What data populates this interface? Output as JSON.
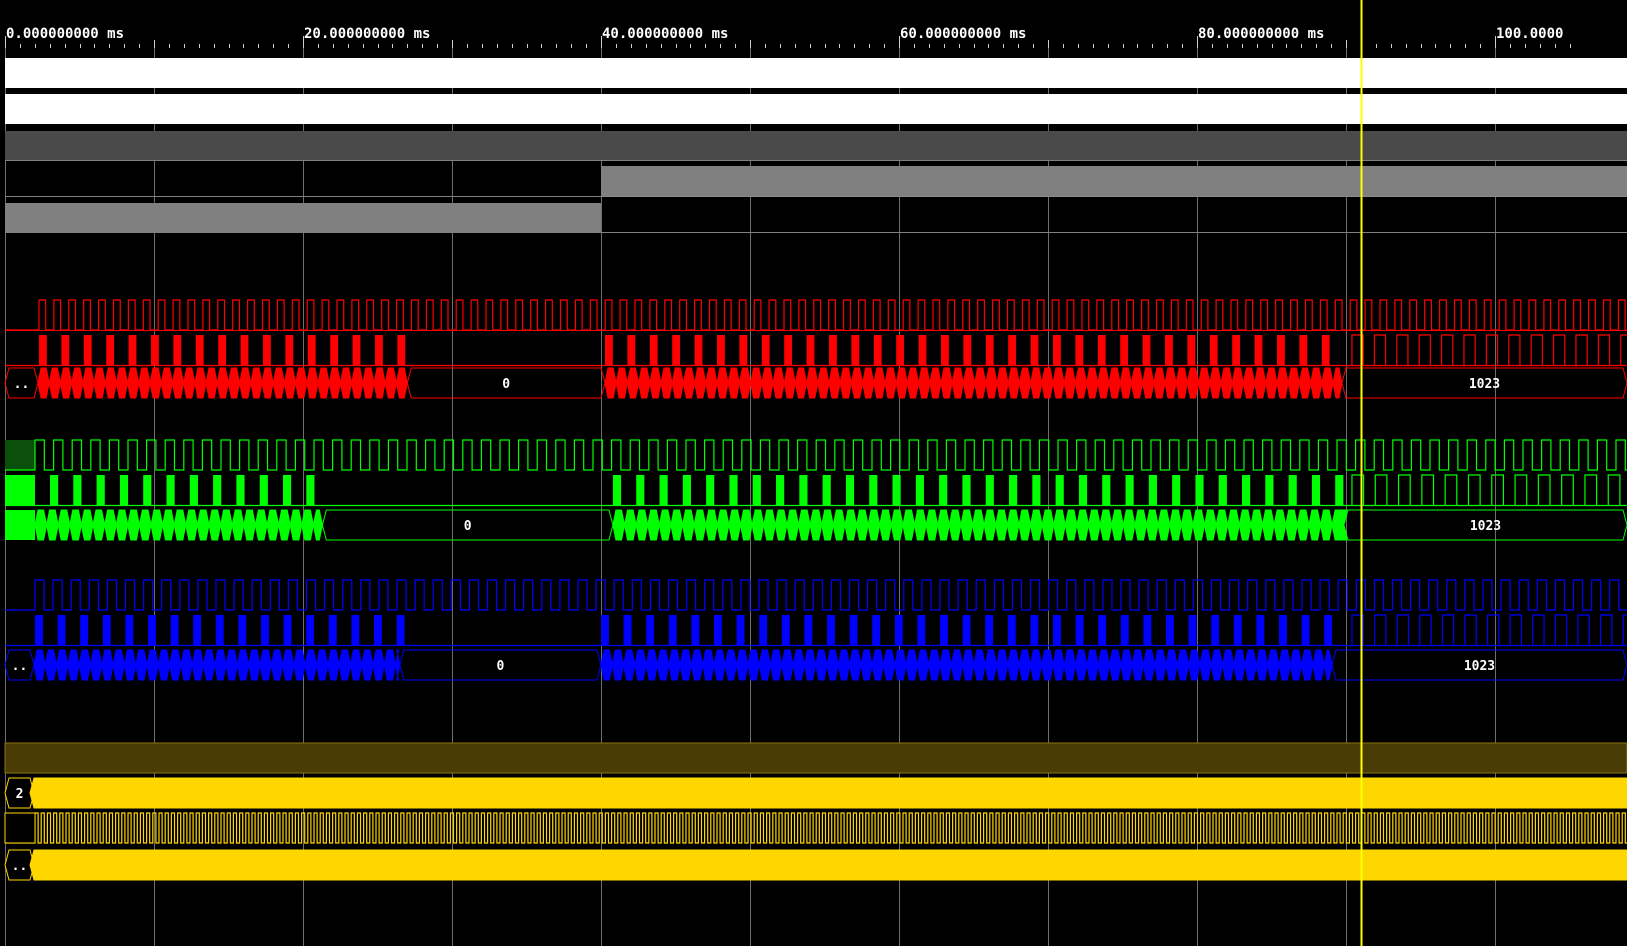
{
  "viewer": {
    "timeline": {
      "unit": "ms",
      "tick_labels": [
        "0.000000000 ms",
        "20.000000000 ms",
        "40.000000000 ms",
        "60.000000000 ms",
        "80.000000000 ms",
        "100.0000"
      ],
      "visible_range_ms": [
        0,
        105
      ],
      "major_tick_ms": 20,
      "grid_step_ms": 10,
      "cursor_ms": 91
    },
    "colors": {
      "background": "#000000",
      "grid": "#6e6e6e",
      "white": "#ffffff",
      "gray_dark": "#4a4a4a",
      "gray": "#808080",
      "red": "#ff0000",
      "green": "#00ff00",
      "blue": "#0000ff",
      "yellow": "#ffd700",
      "yellow_dark": "#4a3c05",
      "cursor": "#ffff00"
    },
    "signals": [
      {
        "id": "white-1",
        "kind": "solid",
        "color": "white",
        "label": ""
      },
      {
        "id": "white-2",
        "kind": "solid",
        "color": "white",
        "label": ""
      },
      {
        "id": "gray-bus",
        "kind": "solid",
        "color": "gray_dark",
        "label": ""
      },
      {
        "id": "gray-high-after-40",
        "kind": "step",
        "color": "gray",
        "label": ""
      },
      {
        "id": "gray-high-before-40",
        "kind": "step",
        "color": "gray",
        "label": ""
      },
      {
        "id": "red-clock",
        "kind": "clock",
        "color": "red",
        "label": ""
      },
      {
        "id": "red-data",
        "kind": "pulse",
        "color": "red",
        "label": ""
      },
      {
        "id": "red-bus",
        "kind": "bus",
        "color": "red",
        "values": [
          "..",
          "0",
          "1023"
        ]
      },
      {
        "id": "green-clock",
        "kind": "clock",
        "color": "green",
        "label": ""
      },
      {
        "id": "green-data",
        "kind": "pulse",
        "color": "green",
        "label": ""
      },
      {
        "id": "green-bus",
        "kind": "bus",
        "color": "green",
        "values": [
          "0",
          "1023"
        ]
      },
      {
        "id": "blue-clock",
        "kind": "clock",
        "color": "blue",
        "label": ""
      },
      {
        "id": "blue-data",
        "kind": "pulse",
        "color": "blue",
        "label": ""
      },
      {
        "id": "blue-bus",
        "kind": "bus",
        "color": "blue",
        "values": [
          "..",
          "0",
          "1023"
        ]
      },
      {
        "id": "yellow-dark-bus",
        "kind": "solid",
        "color": "yellow_dark",
        "label": ""
      },
      {
        "id": "yellow-bus-2",
        "kind": "bus",
        "color": "yellow",
        "values": [
          "2"
        ]
      },
      {
        "id": "yellow-clock",
        "kind": "clock",
        "color": "yellow",
        "label": ""
      },
      {
        "id": "yellow-bus-dots",
        "kind": "bus",
        "color": "yellow",
        "values": [
          ".."
        ]
      }
    ]
  }
}
